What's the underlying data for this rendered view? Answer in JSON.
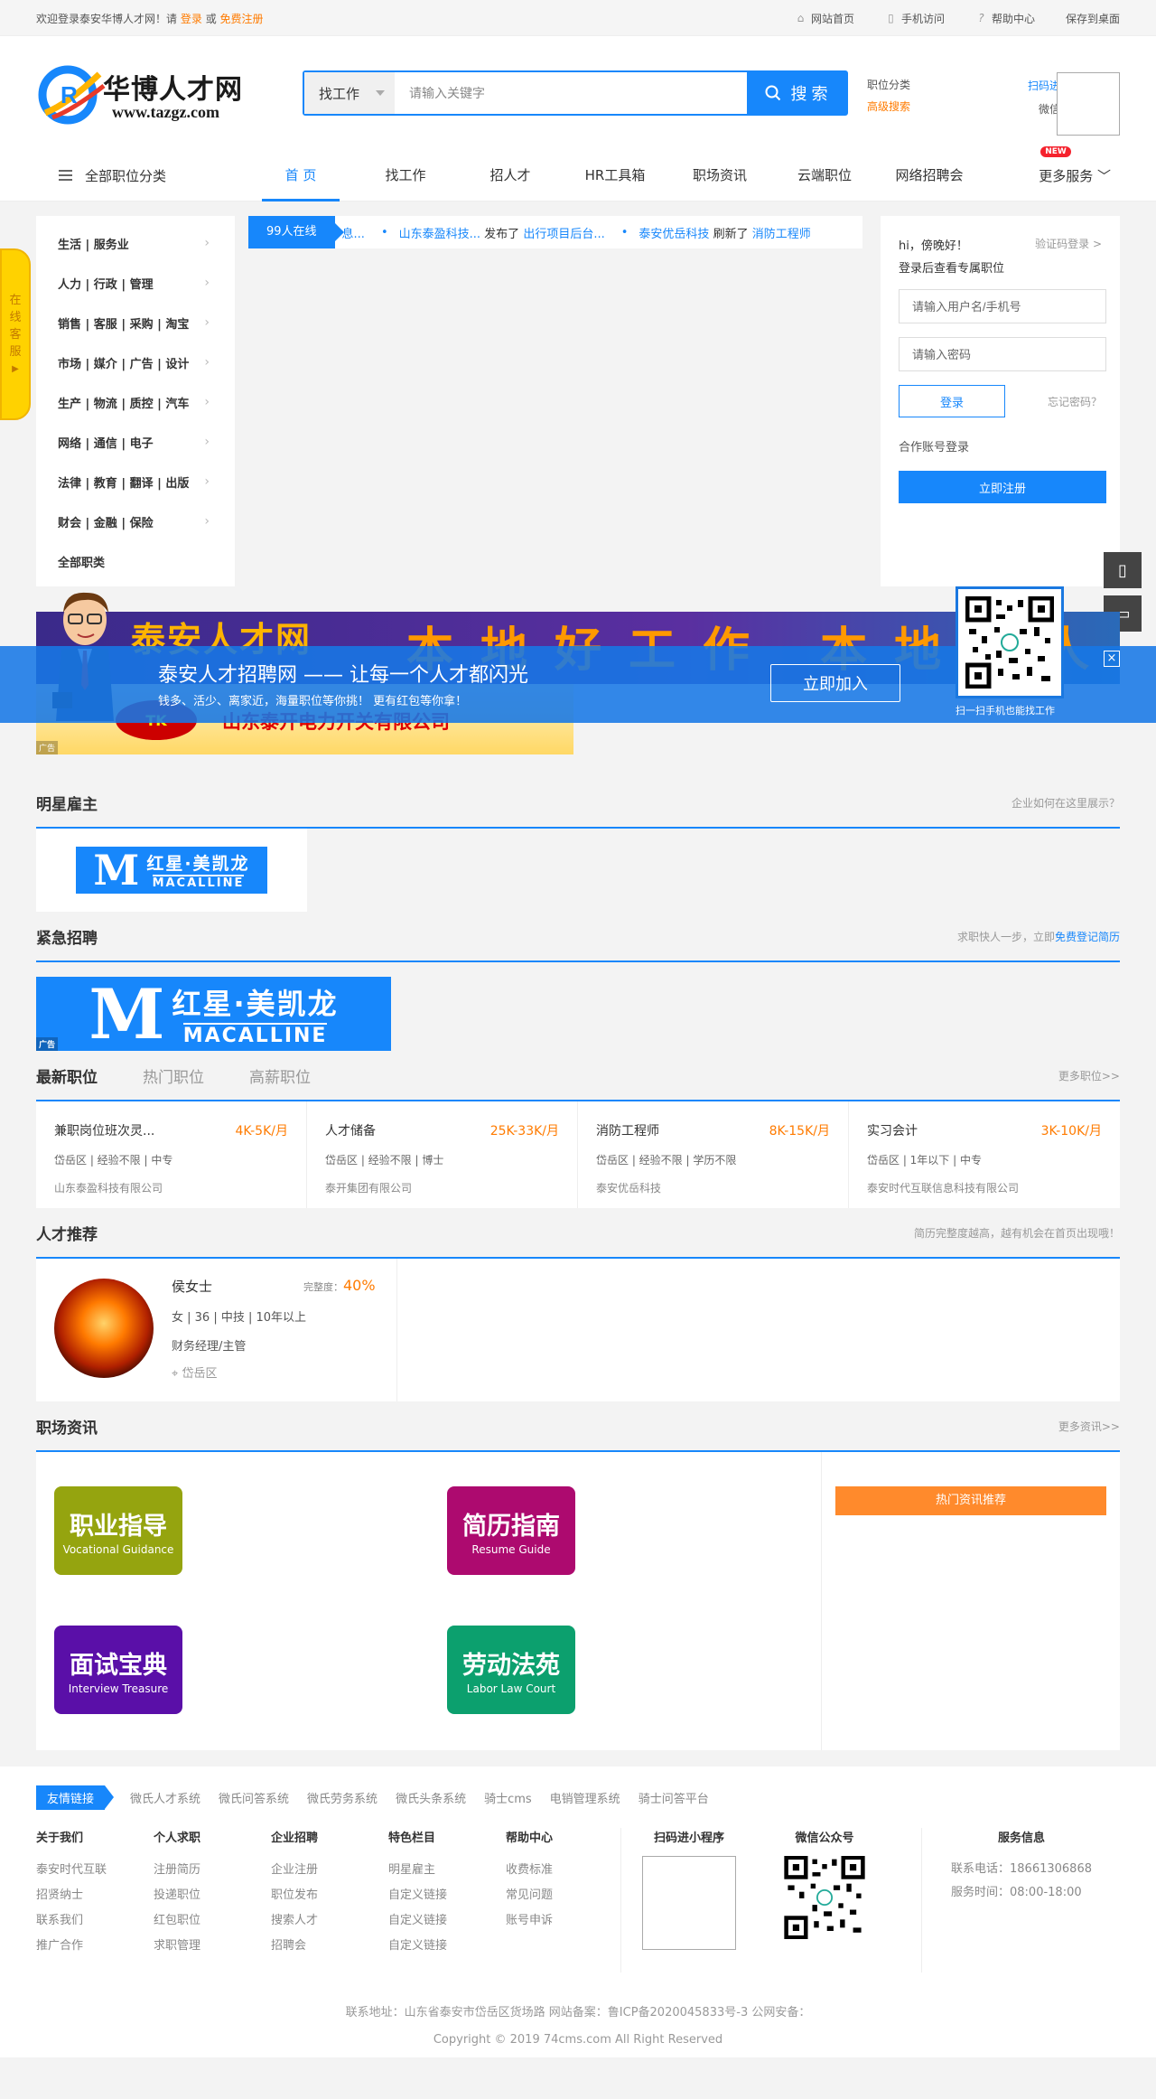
{
  "topbar": {
    "welcome": "欢迎登录泰安华博人才网！请",
    "login": "登录",
    "or": "或",
    "register": "免费注册",
    "links": [
      "网站首页",
      "手机访问",
      "帮助中心",
      "保存到桌面"
    ]
  },
  "header": {
    "logo_cn": "华博人才网",
    "logo_url": "www.tazgz.com",
    "search_type": "找工作",
    "search_placeholder": "请输入关键字",
    "search_button": "搜 索",
    "link_category": "职位分类",
    "link_advanced": "高级搜索",
    "mini_program": "扫码进小程序",
    "wechat": "微信公众号"
  },
  "nav": {
    "all_categories": "全部职位分类",
    "items": [
      "首 页",
      "找工作",
      "招人才",
      "HR工具箱",
      "职场资讯",
      "云端职位",
      "网络招聘会"
    ],
    "more": "更多服务",
    "new_badge": "NEW"
  },
  "categories": [
    "生活 | 服务业",
    "人力 | 行政 | 管理",
    "销售 | 客服 | 采购 | 淘宝",
    "市场 | 媒介 | 广告 | 设计",
    "生产 | 物流 | 质控 | 汽车",
    "网络 | 通信 | 电子",
    "法律 | 教育 | 翻译 | 出版",
    "财会 | 金融 | 保险",
    "全部职类"
  ],
  "ticker": {
    "online": "99人在线",
    "prefix": "息...",
    "company1": "山东泰盈科技...",
    "verb1": "发布了",
    "job1": "出行项目后台...",
    "company2": "泰安优岳科技",
    "verb2": "刷新了",
    "job2": "消防工程师"
  },
  "login": {
    "hi": "hi，傍晚好！",
    "switch": "验证码登录 >",
    "sub": "登录后查看专属职位",
    "user_placeholder": "请输入用户名/手机号",
    "pass_placeholder": "请输入密码",
    "login_btn": "登录",
    "forgot": "忘记密码？",
    "partner": "合作账号登录",
    "register_btn": "立即注册"
  },
  "kefu": [
    "在",
    "线",
    "客",
    "服"
  ],
  "ads": {
    "banner1_a": "泰安人才网",
    "banner1_b": "本地好工作 本地好人",
    "banner2_logo": "TK",
    "banner2": "山东泰开电力开关有限公司",
    "tag": "广告"
  },
  "promo": {
    "head": "泰安人才招聘网 —— 让每一个人才都闪光",
    "sub": "钱多、活少、离家近，海量职位等你挑！ 更有红包等你拿！",
    "join": "立即加入",
    "qr_text": "扫一扫手机也能找工作",
    "close": "×"
  },
  "famous": {
    "title": "明星雇主",
    "right": "企业如何在这里展示？",
    "logo_cn": "红星·美凯龙",
    "logo_en": "MACALLINE",
    "logo_m": "M"
  },
  "urgent": {
    "title": "紧急招聘",
    "right_prefix": "求职快人一步，立即",
    "right_link": "免费登记简历"
  },
  "jobtabs": {
    "tabs": [
      "最新职位",
      "热门职位",
      "高薪职位"
    ],
    "more": "更多职位>>"
  },
  "jobs": [
    {
      "title": "兼职岗位班次灵...",
      "salary": "4K-5K/月",
      "meta": "岱岳区 | 经验不限 | 中专",
      "company": "山东泰盈科技有限公司"
    },
    {
      "title": "人才储备",
      "salary": "25K-33K/月",
      "meta": "岱岳区 | 经验不限 | 博士",
      "company": "泰开集团有限公司"
    },
    {
      "title": "消防工程师",
      "salary": "8K-15K/月",
      "meta": "岱岳区 | 经验不限 | 学历不限",
      "company": "泰安优岳科技"
    },
    {
      "title": "实习会计",
      "salary": "3K-10K/月",
      "meta": "岱岳区 | 1年以下 | 中专",
      "company": "泰安时代互联信息科技有限公司"
    }
  ],
  "talent": {
    "title": "人才推荐",
    "right": "简历完整度越高，越有机会在首页出现哦！",
    "name": "侯女士",
    "complete_label": "完整度：",
    "complete": "40%",
    "info": "女 | 36 | 中技 | 10年以上",
    "position": "财务经理/主管",
    "location": "岱岳区"
  },
  "news": {
    "title": "职场资讯",
    "more": "更多资讯>>",
    "tiles": [
      {
        "zh": "职业指导",
        "en": "Vocational Guidance"
      },
      {
        "zh": "简历指南",
        "en": "Resume Guide"
      },
      {
        "zh": "面试宝典",
        "en": "Interview Treasure"
      },
      {
        "zh": "劳动法苑",
        "en": "Labor Law Court"
      }
    ],
    "hot": "热门资讯推荐"
  },
  "footer": {
    "friend_tag": "友情链接",
    "friends": [
      "微氏人才系统",
      "微氏问答系统",
      "微氏劳务系统",
      "微氏头条系统",
      "骑士cms",
      "电销管理系统",
      "骑士问答平台"
    ],
    "cols": [
      {
        "h": "关于我们",
        "items": [
          "泰安时代互联",
          "招贤纳士",
          "联系我们",
          "推广合作"
        ]
      },
      {
        "h": "个人求职",
        "items": [
          "注册简历",
          "投递职位",
          "红包职位",
          "求职管理"
        ]
      },
      {
        "h": "企业招聘",
        "items": [
          "企业注册",
          "职位发布",
          "搜索人才",
          "招聘会"
        ]
      },
      {
        "h": "特色栏目",
        "items": [
          "明星雇主",
          "自定义链接",
          "自定义链接",
          "自定义链接"
        ]
      },
      {
        "h": "帮助中心",
        "items": [
          "收费标准",
          "常见问题",
          "账号申诉"
        ]
      }
    ],
    "qr1": "扫码进小程序",
    "qr2": "微信公众号",
    "svc_title": "服务信息",
    "phone": "联系电话：18661306868",
    "hours": "服务时间：08:00-18:00",
    "address": "联系地址：山东省泰安市岱岳区货场路 网站备案：鲁ICP备2020045833号-3 公网安备：",
    "copyright": "Copyright © 2019 74cms.com All Right Reserved"
  },
  "colors": {
    "primary": "#1787fb",
    "orange": "#ff7b00"
  }
}
